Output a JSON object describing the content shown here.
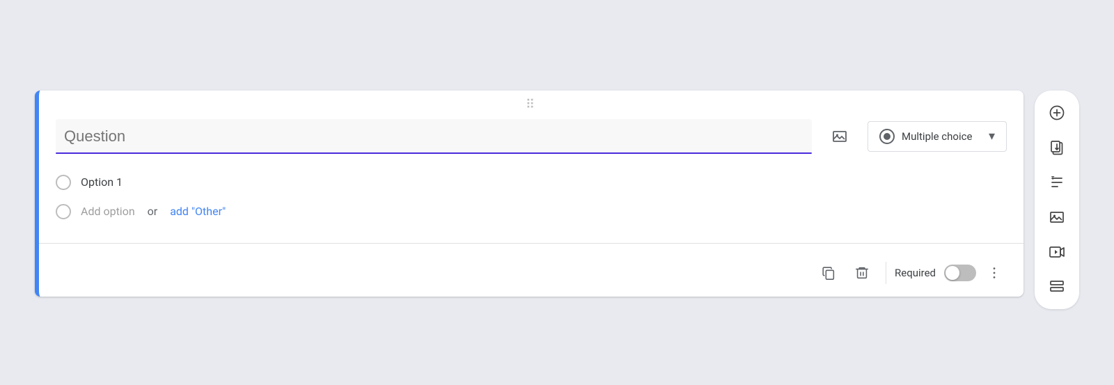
{
  "card": {
    "question_placeholder": "Question",
    "question_value": "",
    "type_label": "Multiple choice",
    "option1_label": "Option 1",
    "add_option_label": "Add option",
    "or_label": "or",
    "add_other_label": "add \"Other\"",
    "required_label": "Required"
  },
  "sidebar": {
    "add_label": "Add question",
    "import_label": "Import questions",
    "title_label": "Add title and description",
    "image_label": "Add image",
    "video_label": "Add video",
    "section_label": "Add section"
  },
  "footer": {
    "copy_label": "Duplicate",
    "delete_label": "Delete",
    "more_label": "More options"
  }
}
